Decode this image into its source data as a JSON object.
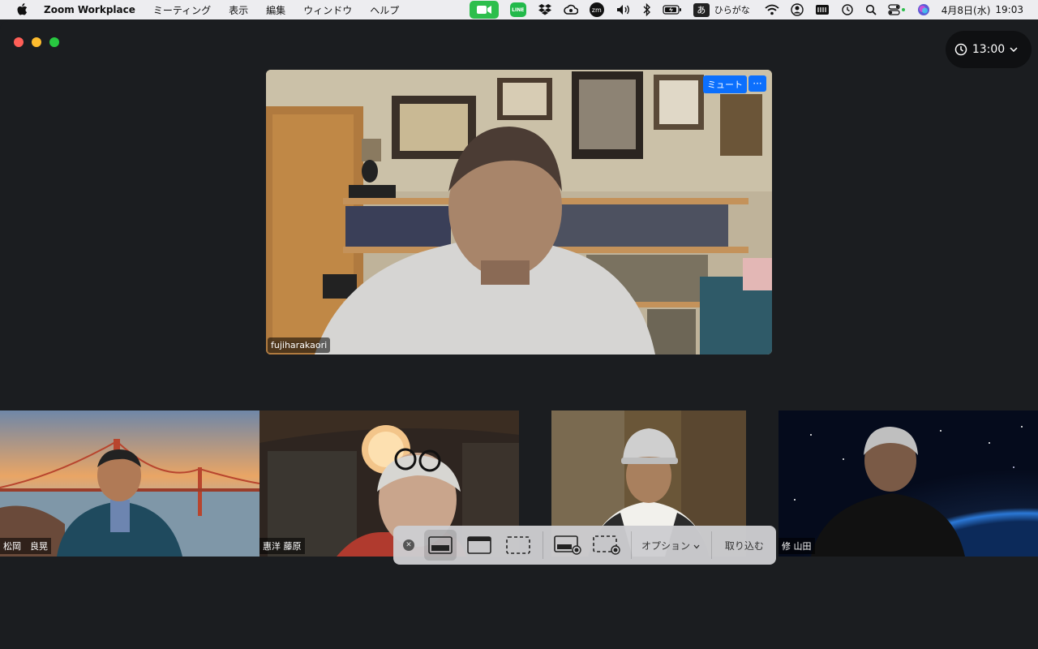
{
  "menubar": {
    "app_name": "Zoom Workplace",
    "menus": [
      "ミーティング",
      "表示",
      "編集",
      "ウィンドウ",
      "ヘルプ"
    ],
    "line_label": "LINE",
    "zm_label": "zm",
    "ime_symbol": "あ",
    "ime_label": "ひらがな",
    "date": "4月8日(水)",
    "time": "19:03"
  },
  "window": {
    "meeting_timer": "13:00",
    "main_video": {
      "participant_name": "fujiharakaori",
      "mute_label": "ミュート",
      "more_label": "···"
    },
    "gallery": [
      {
        "name": "松岡　良晃"
      },
      {
        "name": "惠洋 藤原"
      },
      {
        "name": ""
      },
      {
        "name": "修 山田"
      }
    ]
  },
  "screenshot_toolbar": {
    "options_label": "オプション",
    "capture_label": "取り込む"
  },
  "colors": {
    "accent_blue": "#0b6ffd",
    "zoom_green": "#2dbe4c",
    "window_bg": "#1b1d20"
  }
}
